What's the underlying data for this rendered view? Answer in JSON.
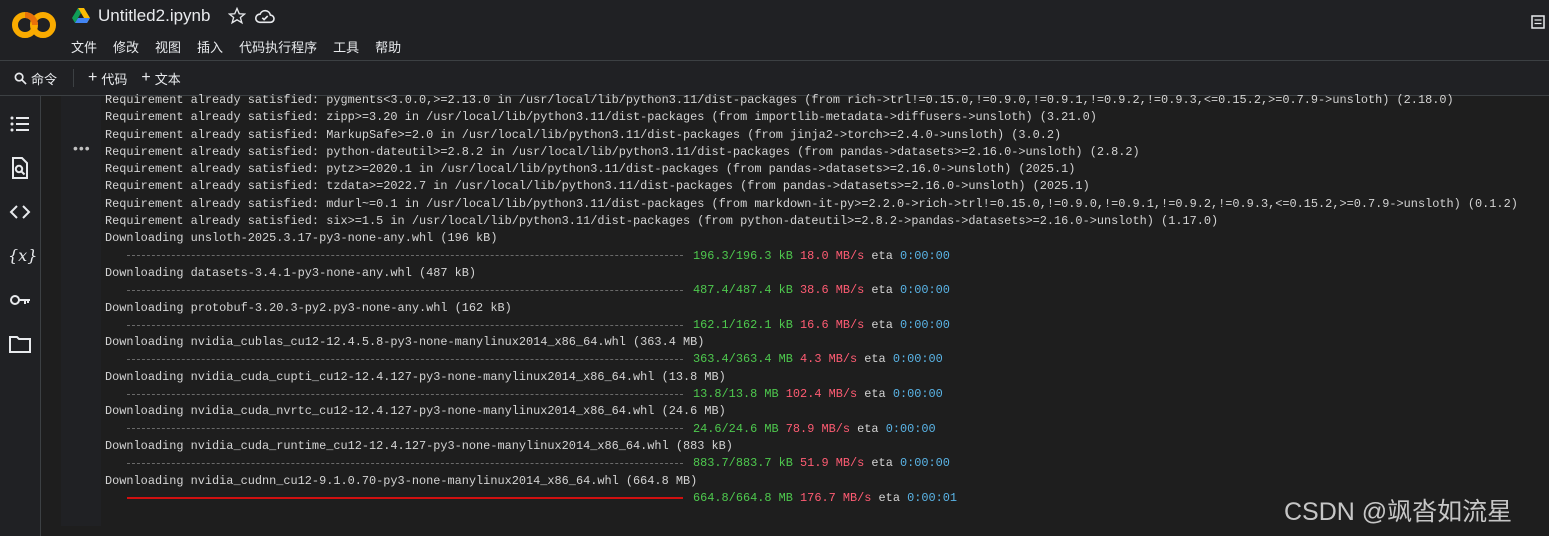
{
  "app": {
    "title": "Untitled2.ipynb",
    "logo": "CO",
    "menu": [
      "文件",
      "修改",
      "视图",
      "插入",
      "代码执行程序",
      "工具",
      "帮助"
    ]
  },
  "toolbar": {
    "command_label": "命令",
    "add_code_label": "代码",
    "add_text_label": "文本"
  },
  "sidebar": {
    "icons": [
      "toc-icon",
      "find-icon",
      "code-snippets-icon",
      "variables-icon",
      "secrets-icon",
      "files-icon"
    ],
    "variables_glyph": "{x}"
  },
  "cell": {
    "menu_glyph": "•••"
  },
  "output": {
    "lines": [
      "Requirement already satisfied: pygments<3.0.0,>=2.13.0 in /usr/local/lib/python3.11/dist-packages (from rich->trl!=0.15.0,!=0.9.0,!=0.9.1,!=0.9.2,!=0.9.3,<=0.15.2,>=0.7.9->unsloth) (2.18.0)",
      "Requirement already satisfied: zipp>=3.20 in /usr/local/lib/python3.11/dist-packages (from importlib-metadata->diffusers->unsloth) (3.21.0)",
      "Requirement already satisfied: MarkupSafe>=2.0 in /usr/local/lib/python3.11/dist-packages (from jinja2->torch>=2.4.0->unsloth) (3.0.2)",
      "Requirement already satisfied: python-dateutil>=2.8.2 in /usr/local/lib/python3.11/dist-packages (from pandas->datasets>=2.16.0->unsloth) (2.8.2)",
      "Requirement already satisfied: pytz>=2020.1 in /usr/local/lib/python3.11/dist-packages (from pandas->datasets>=2.16.0->unsloth) (2025.1)",
      "Requirement already satisfied: tzdata>=2022.7 in /usr/local/lib/python3.11/dist-packages (from pandas->datasets>=2.16.0->unsloth) (2025.1)",
      "Requirement already satisfied: mdurl~=0.1 in /usr/local/lib/python3.11/dist-packages (from markdown-it-py>=2.2.0->rich->trl!=0.15.0,!=0.9.0,!=0.9.1,!=0.9.2,!=0.9.3,<=0.15.2,>=0.7.9->unsloth) (0.1.2)",
      "Requirement already satisfied: six>=1.5 in /usr/local/lib/python3.11/dist-packages (from python-dateutil>=2.8.2->pandas->datasets>=2.16.0->unsloth) (1.17.0)"
    ],
    "downloads": [
      {
        "label": "Downloading unsloth-2025.3.17-py3-none-any.whl (196 kB)",
        "size": "196.3/196.3 kB",
        "speed": "18.0 MB/s",
        "eta_label": "eta",
        "eta": "0:00:00",
        "complete": true
      },
      {
        "label": "Downloading datasets-3.4.1-py3-none-any.whl (487 kB)",
        "size": "487.4/487.4 kB",
        "speed": "38.6 MB/s",
        "eta_label": "eta",
        "eta": "0:00:00",
        "complete": true
      },
      {
        "label": "Downloading protobuf-3.20.3-py2.py3-none-any.whl (162 kB)",
        "size": "162.1/162.1 kB",
        "speed": "16.6 MB/s",
        "eta_label": "eta",
        "eta": "0:00:00",
        "complete": true
      },
      {
        "label": "Downloading nvidia_cublas_cu12-12.4.5.8-py3-none-manylinux2014_x86_64.whl (363.4 MB)",
        "size": "363.4/363.4 MB",
        "speed": "4.3 MB/s",
        "eta_label": "eta",
        "eta": "0:00:00",
        "complete": true
      },
      {
        "label": "Downloading nvidia_cuda_cupti_cu12-12.4.127-py3-none-manylinux2014_x86_64.whl (13.8 MB)",
        "size": "13.8/13.8 MB",
        "speed": "102.4 MB/s",
        "eta_label": "eta",
        "eta": "0:00:00",
        "complete": true
      },
      {
        "label": "Downloading nvidia_cuda_nvrtc_cu12-12.4.127-py3-none-manylinux2014_x86_64.whl (24.6 MB)",
        "size": "24.6/24.6 MB",
        "speed": "78.9 MB/s",
        "eta_label": "eta",
        "eta": "0:00:00",
        "complete": true
      },
      {
        "label": "Downloading nvidia_cuda_runtime_cu12-12.4.127-py3-none-manylinux2014_x86_64.whl (883 kB)",
        "size": "883.7/883.7 kB",
        "speed": "51.9 MB/s",
        "eta_label": "eta",
        "eta": "0:00:00",
        "complete": true
      },
      {
        "label": "Downloading nvidia_cudnn_cu12-9.1.0.70-py3-none-manylinux2014_x86_64.whl (664.8 MB)",
        "size": "664.8/664.8 MB",
        "speed": "176.7 MB/s",
        "eta_label": "eta",
        "eta": "0:00:01",
        "complete": false
      }
    ]
  },
  "watermark": "CSDN @飒沓如流星",
  "colors": {
    "size": "#4ec94e",
    "speed": "#ff5c73",
    "eta": "#5ab4e6",
    "active_bar": "#d01010"
  }
}
